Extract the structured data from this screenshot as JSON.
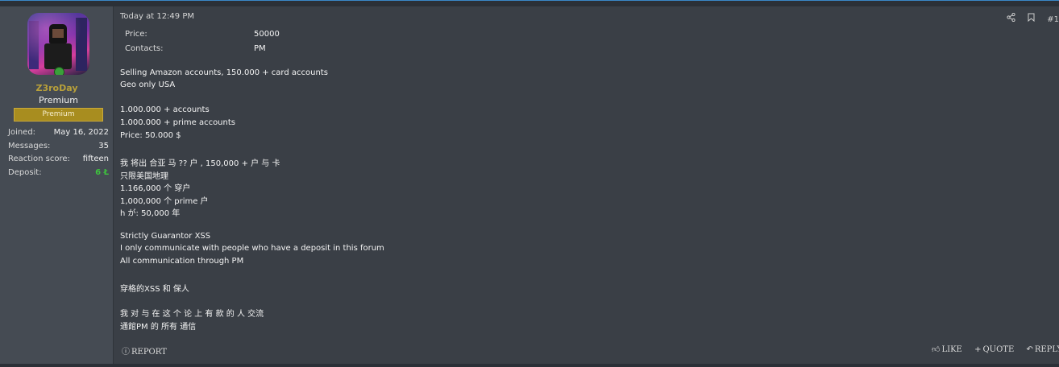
{
  "user": {
    "name": "Z3roDay",
    "title": "Premium",
    "banner": "Premium",
    "stats": [
      {
        "label": "Joined:",
        "value": "May 16, 2022"
      },
      {
        "label": "Messages:",
        "value": "35"
      },
      {
        "label": "Reaction score:",
        "value": "fifteen"
      },
      {
        "label": "Deposit:",
        "value": "6 Ł"
      }
    ]
  },
  "post": {
    "date": "Today at 12:49 PM",
    "post_number": "#1",
    "fields": {
      "price_label": "Price:",
      "price_value": "50000",
      "contacts_label": "Contacts:",
      "contacts_value": "PM"
    },
    "lines": [
      "Selling Amazon accounts, 150.000 + card accounts",
      "Geo only USA",
      "1.000.000 + accounts",
      "1.000.000 + prime accounts",
      "Price: 50.000 $",
      "我 将出 合亚 马 ?? 户 , 150,000 + 户 与 卡",
      "只限美国地理",
      "1.166,000 个 穿户",
      "1,000,000 个 prime 户",
      "h が: 50,000 年",
      "Strictly Guarantor XSS",
      "I only communicate with people who have a deposit in this forum",
      "All communication through PM",
      "穿格的XSS 和 保人",
      "我 对 与 在 这 个 论 上 有 款 的 人 交流",
      "通館PM 的 所有 通信"
    ],
    "footer": {
      "report": "REPORT",
      "like": "LIKE",
      "quote": "QUOTE",
      "reply": "REPLY"
    }
  },
  "colors": {
    "username": "#b8a03a",
    "banner": "#a88d1f",
    "deposit": "#3ec13e",
    "background": "#3a3f46"
  }
}
